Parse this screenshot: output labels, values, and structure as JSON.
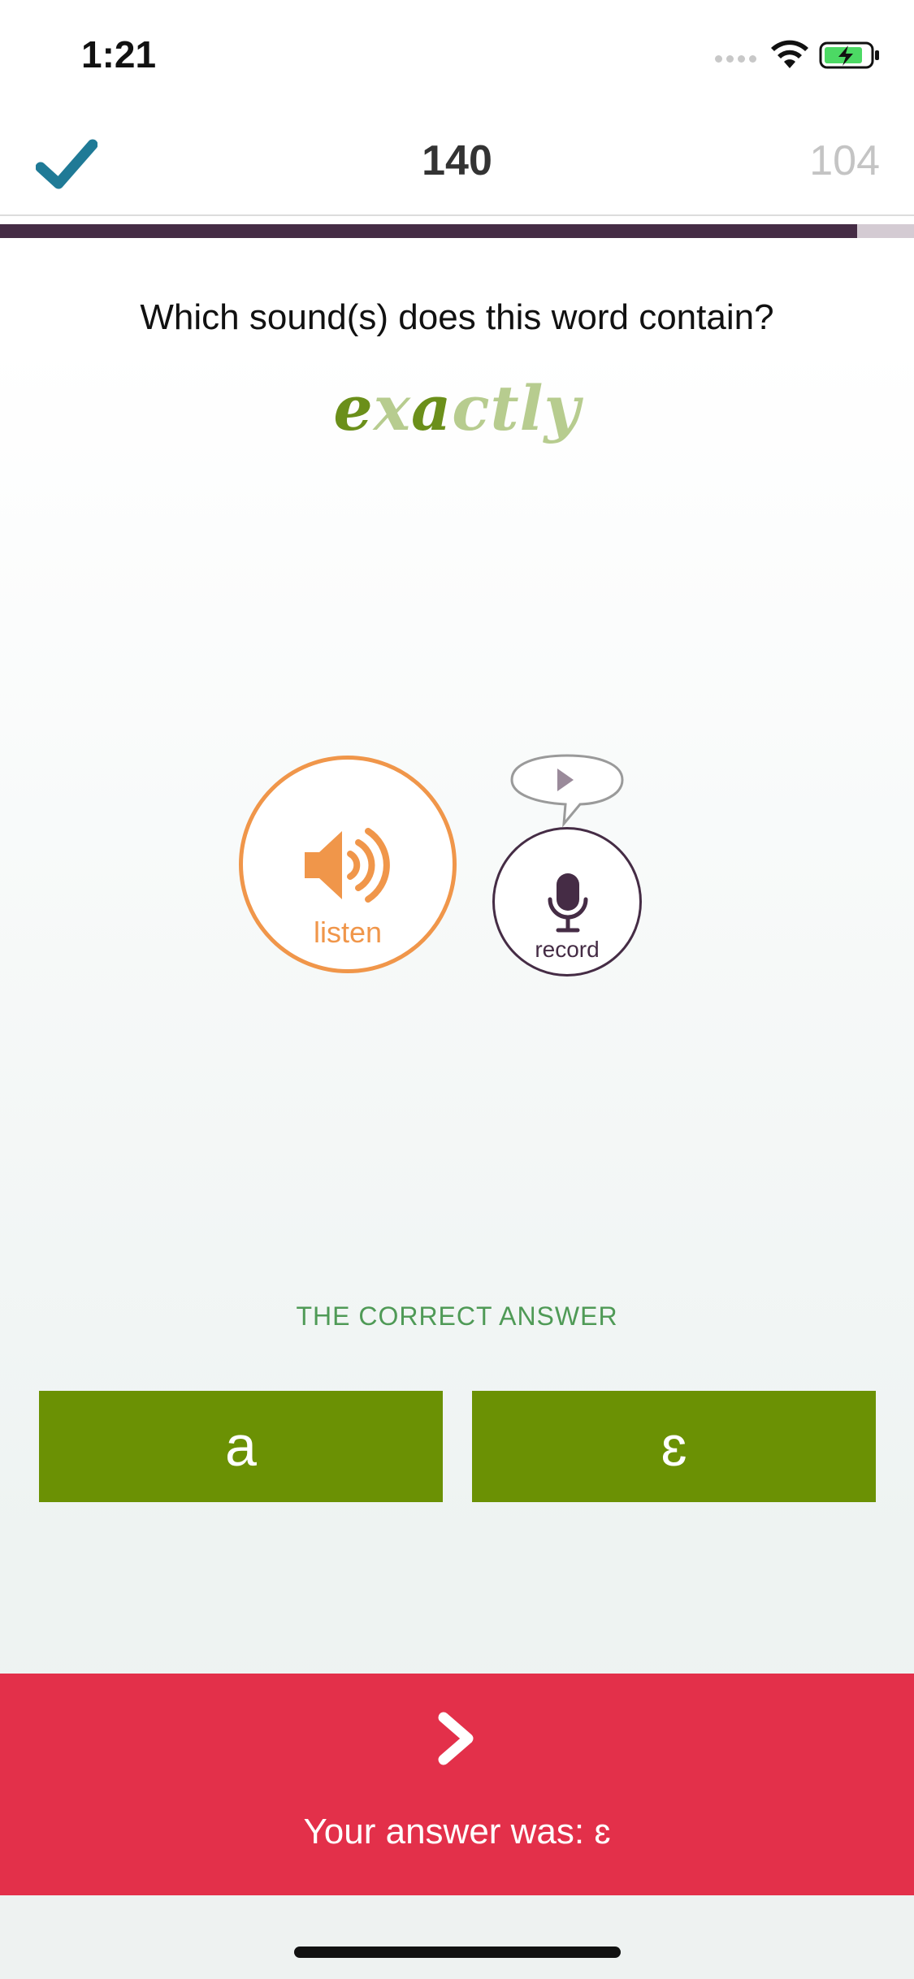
{
  "status_bar": {
    "time": "1:21"
  },
  "header": {
    "score": "140",
    "remaining": "104",
    "progress": 0.938
  },
  "question": "Which sound(s) does this word contain?",
  "word": {
    "parts": [
      "e",
      "x",
      "a",
      "ctly"
    ]
  },
  "listen": {
    "label": "listen"
  },
  "record": {
    "label": "record"
  },
  "answer": {
    "heading": "THE CORRECT ANSWER",
    "options": [
      "a",
      "ɛ"
    ]
  },
  "feedback": {
    "text": "Your answer was: ɛ"
  },
  "colors": {
    "accent_orange": "#f0964a",
    "accent_purple": "#452c45",
    "answer_green": "#6b9104",
    "feedback_red": "#e3304a",
    "check_blue": "#1f7a96"
  }
}
